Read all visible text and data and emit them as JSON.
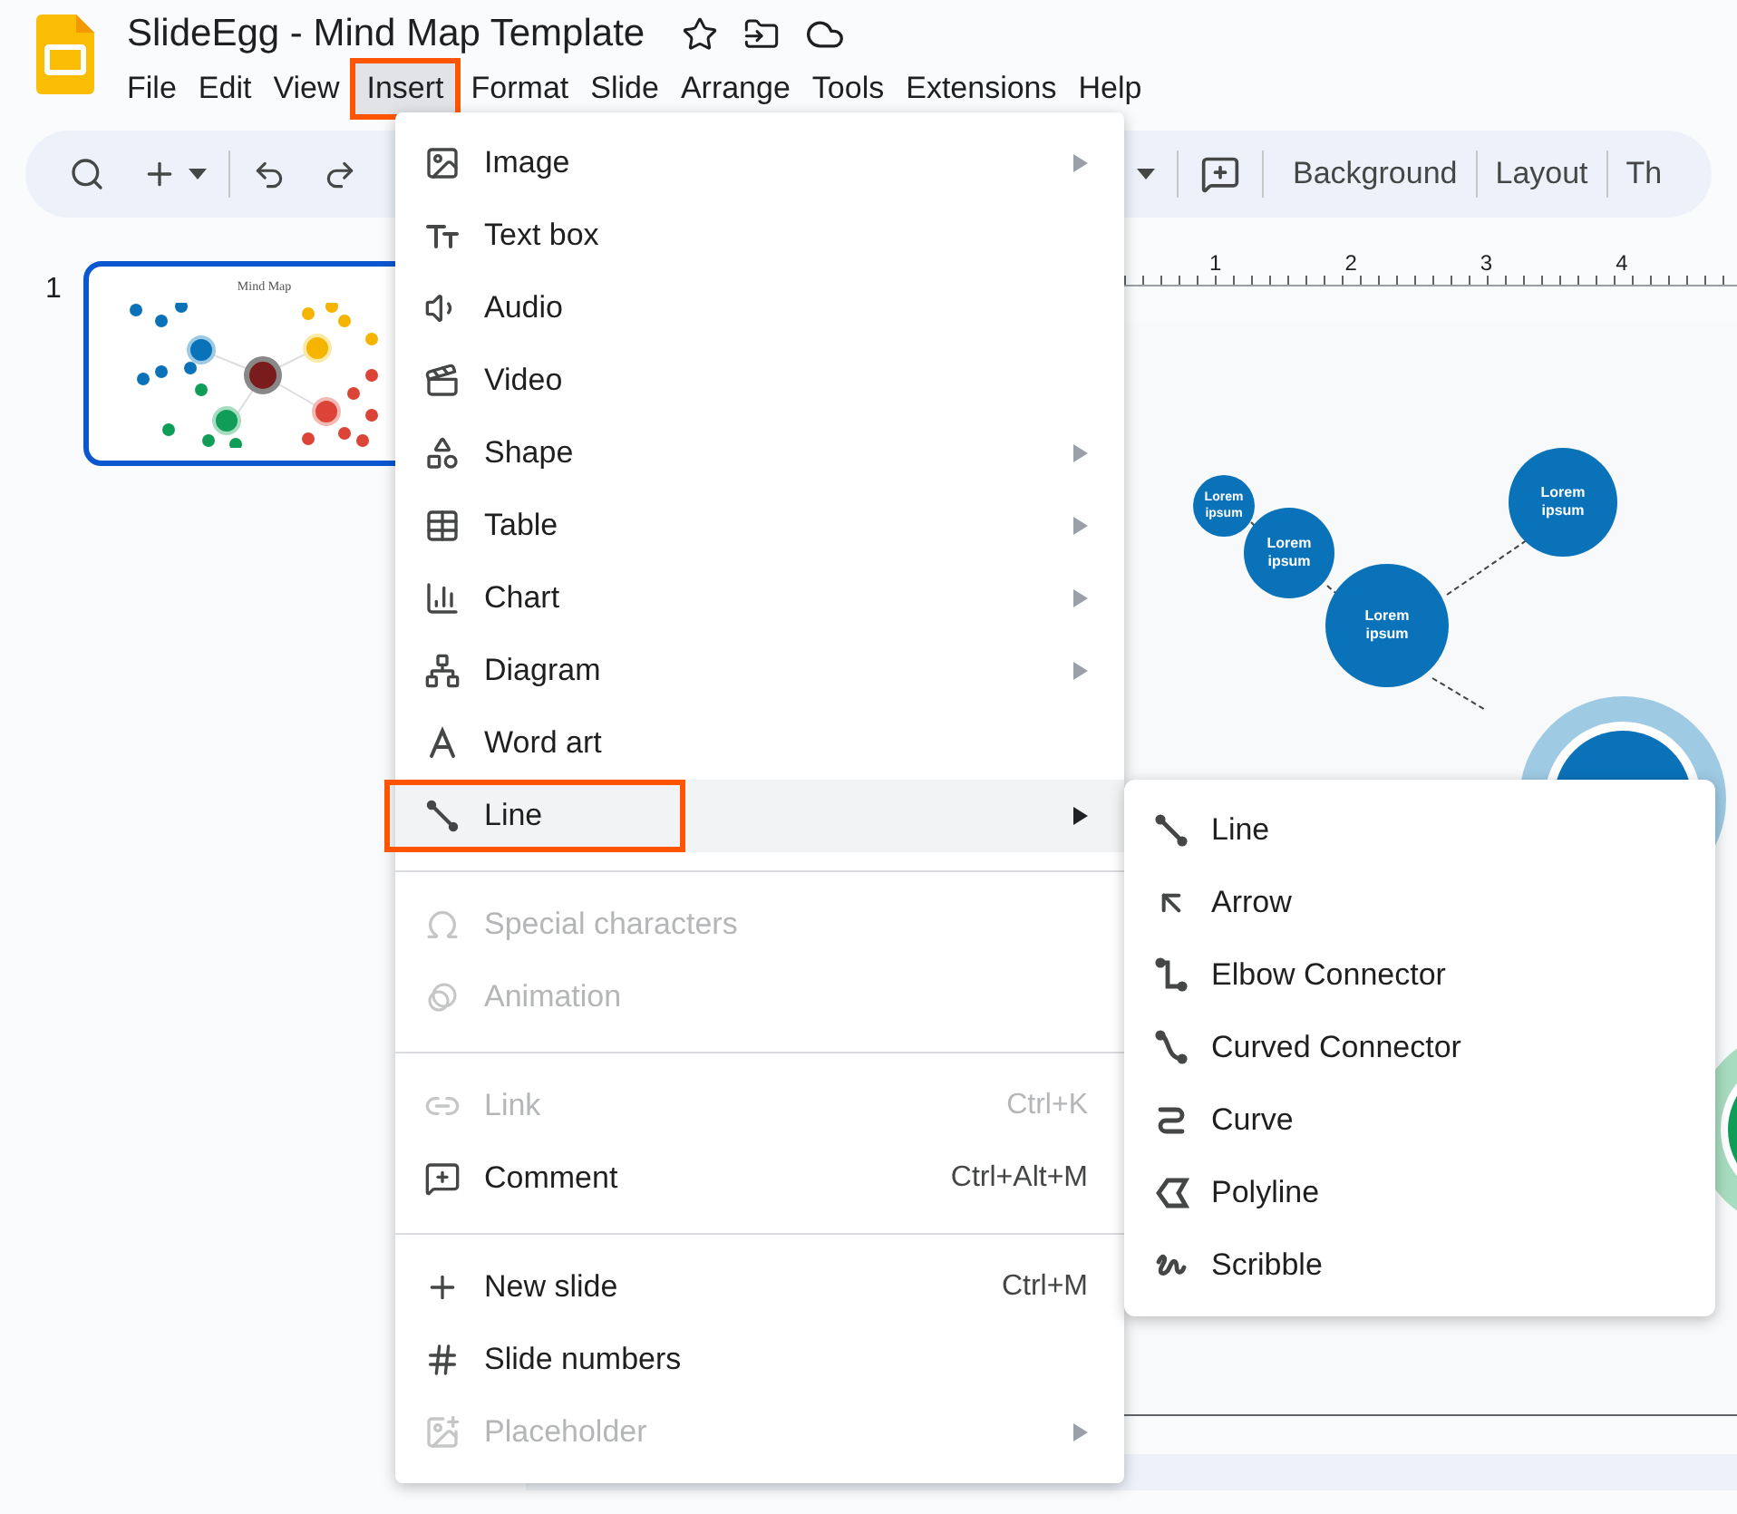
{
  "app": {
    "title": "SlideEgg - Mind Map Template"
  },
  "menubar": [
    {
      "label": "File",
      "selected": false
    },
    {
      "label": "Edit",
      "selected": false
    },
    {
      "label": "View",
      "selected": false
    },
    {
      "label": "Insert",
      "selected": true
    },
    {
      "label": "Format",
      "selected": false
    },
    {
      "label": "Slide",
      "selected": false
    },
    {
      "label": "Arrange",
      "selected": false
    },
    {
      "label": "Tools",
      "selected": false
    },
    {
      "label": "Extensions",
      "selected": false
    },
    {
      "label": "Help",
      "selected": false
    }
  ],
  "toolbar": {
    "buttons": [
      "Background",
      "Layout",
      "Th"
    ]
  },
  "ruler": [
    "1",
    "2",
    "3",
    "4"
  ],
  "filmstrip": [
    {
      "number": "1",
      "title": "Mind Map",
      "selected": true
    }
  ],
  "slide": {
    "nodes": [
      {
        "text": "Lorem ipsum"
      },
      {
        "text": "Lorem ipsum"
      },
      {
        "text": "Lorem ipsum"
      },
      {
        "text": "Lorem ipsum"
      }
    ]
  },
  "insert_menu": {
    "sections": [
      [
        {
          "label": "Image",
          "submenu": true,
          "disabled": false,
          "selected": false
        },
        {
          "label": "Text box",
          "submenu": false,
          "disabled": false,
          "selected": false
        },
        {
          "label": "Audio",
          "submenu": false,
          "disabled": false,
          "selected": false
        },
        {
          "label": "Video",
          "submenu": false,
          "disabled": false,
          "selected": false
        },
        {
          "label": "Shape",
          "submenu": true,
          "disabled": false,
          "selected": false
        },
        {
          "label": "Table",
          "submenu": true,
          "disabled": false,
          "selected": false
        },
        {
          "label": "Chart",
          "submenu": true,
          "disabled": false,
          "selected": false
        },
        {
          "label": "Diagram",
          "submenu": true,
          "disabled": false,
          "selected": false
        },
        {
          "label": "Word art",
          "submenu": false,
          "disabled": false,
          "selected": false
        },
        {
          "label": "Line",
          "submenu": true,
          "disabled": false,
          "selected": true
        }
      ],
      [
        {
          "label": "Special characters",
          "submenu": false,
          "disabled": true,
          "selected": false
        },
        {
          "label": "Animation",
          "submenu": false,
          "disabled": true,
          "selected": false
        }
      ],
      [
        {
          "label": "Link",
          "shortcut": "Ctrl+K",
          "submenu": false,
          "disabled": true,
          "selected": false
        },
        {
          "label": "Comment",
          "shortcut": "Ctrl+Alt+M",
          "submenu": false,
          "disabled": false,
          "selected": false
        }
      ],
      [
        {
          "label": "New slide",
          "shortcut": "Ctrl+M",
          "submenu": false,
          "disabled": false,
          "selected": false
        },
        {
          "label": "Slide numbers",
          "submenu": false,
          "disabled": false,
          "selected": false
        },
        {
          "label": "Placeholder",
          "submenu": true,
          "disabled": true,
          "selected": false
        }
      ]
    ]
  },
  "line_submenu": {
    "items": [
      {
        "label": "Line"
      },
      {
        "label": "Arrow"
      },
      {
        "label": "Elbow Connector"
      },
      {
        "label": "Curved Connector"
      },
      {
        "label": "Curve"
      },
      {
        "label": "Polyline"
      },
      {
        "label": "Scribble"
      }
    ]
  }
}
